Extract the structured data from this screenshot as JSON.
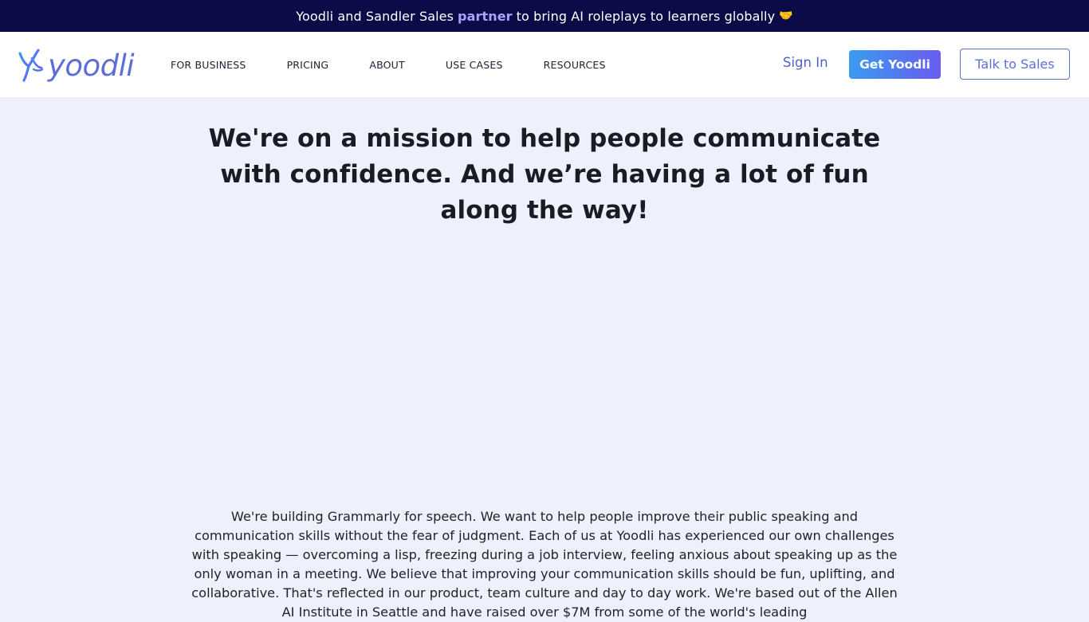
{
  "announcement": {
    "text_before": "Yoodli and Sandler Sales",
    "highlight": "partner",
    "text_after": "to bring AI roleplays to learners globally",
    "emoji": "🤝",
    "bg_color": "#0b0b47",
    "highlight_color": "#a9a3ff"
  },
  "header": {
    "logo_text": "yoodli",
    "logo_icon": "yoodli-swirl-icon",
    "nav": [
      {
        "label": "FOR BUSINESS"
      },
      {
        "label": "PRICING"
      },
      {
        "label": "ABOUT"
      },
      {
        "label": "USE CASES"
      },
      {
        "label": "RESOURCES"
      }
    ],
    "sign_in": "Sign In",
    "get_button": "Get Yoodli",
    "sales_button": "Talk to Sales",
    "brand_color": "#5d6fd6"
  },
  "main": {
    "headline": "We're on a mission to help people communicate with confidence. And we’re having a lot of fun along the way!",
    "body": "We're building Grammarly for speech. We want to help people improve their public speaking and communication skills without the fear of judgment. Each of us at Yoodli has experienced our own challenges with speaking — overcoming a lisp, freezing during a job interview, feeling anxious about speaking up as the only woman in a meeting. We believe that improving your communication skills should be fun, uplifting, and collaborative. That's reflected in our product, team culture and day to day work. We're based out of the Allen AI Institute in Seattle and have raised over $7M from some of the world's leading"
  }
}
